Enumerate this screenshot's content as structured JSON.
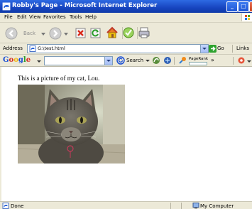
{
  "window": {
    "title": "Robby's Page - Microsoft Internet Explorer"
  },
  "menu": {
    "items": [
      "File",
      "Edit",
      "View",
      "Favorites",
      "Tools",
      "Help"
    ]
  },
  "toolbar": {
    "back_label": "Back"
  },
  "address": {
    "label": "Address",
    "value": "G:\\test.html",
    "go_label": "Go",
    "links_label": "Links"
  },
  "google": {
    "logo": "Google",
    "search_label": "Search",
    "pagerank_label": "PageRank"
  },
  "page": {
    "text": "This is a picture of my cat, Lou."
  },
  "status": {
    "text": "Done",
    "zone": "My Computer"
  }
}
